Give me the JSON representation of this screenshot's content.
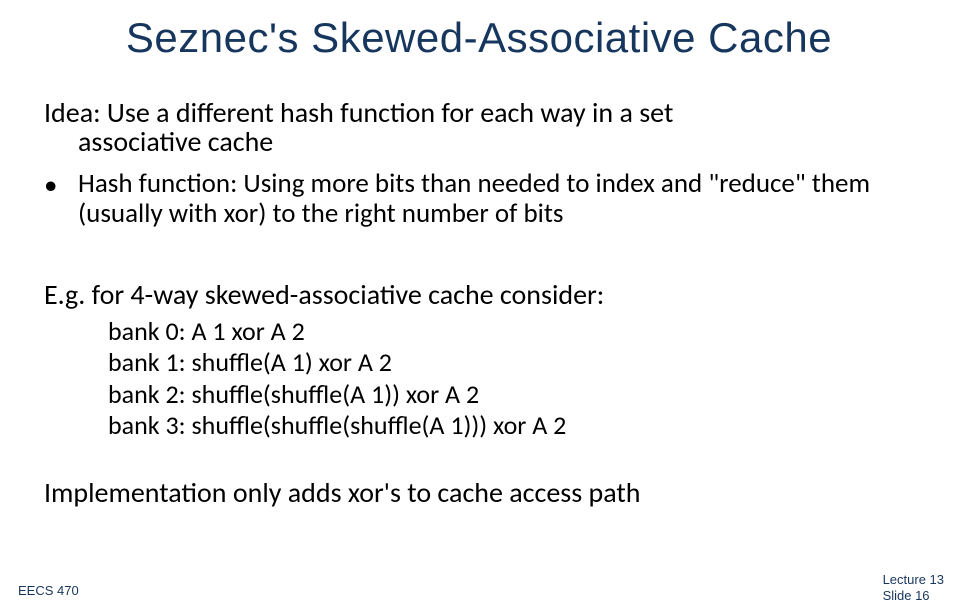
{
  "title": "Seznec's Skewed-Associative Cache",
  "idea_line1": "Idea: Use a different hash function for each way in a set",
  "idea_line2": "associative cache",
  "bullet": "Hash function: Using more bits than needed to index and \"reduce\" them (usually with xor) to the right number of bits",
  "eg": "E.g. for 4-way skewed-associative cache consider:",
  "banks": {
    "b0": "bank 0: A 1 xor A 2",
    "b1": "bank 1: shuffle(A 1) xor A 2",
    "b2": "bank 2: shuffle(shuffle(A 1)) xor A 2",
    "b3": "bank 3: shuffle(shuffle(shuffle(A 1))) xor A 2"
  },
  "impl": "Implementation only adds xor's to cache access path",
  "footer_left": "EECS 470",
  "footer_right_line1": "Lecture 13",
  "footer_right_line2": "Slide 16"
}
